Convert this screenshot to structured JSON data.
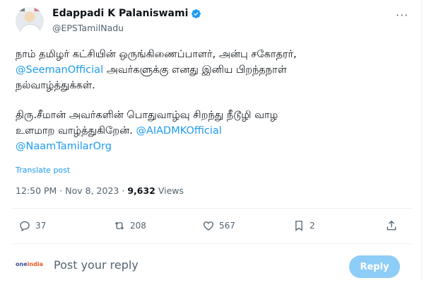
{
  "author": {
    "display_name": "Edappadi K Palaniswami",
    "handle": "@EPSTamilNadu",
    "verified": true
  },
  "tweet": {
    "para1_line1": "நாம் தமிழர் கட்சியின் ஒருங்கிணைப்பாளர், அன்பு சகோதரர்,",
    "para1_mention": "@SeemanOfficial",
    "para1_line2_rest": " அவர்களுக்கு எனது இனிய பிறந்தநாள்",
    "para1_line3": "நல்வாழ்த்துக்கள்.",
    "para2_line1": "திரு.சீமான் அவர்களின் பொதுவாழ்வு சிறந்து நீடூழி வாழ",
    "para2_line2": "உளமாற வாழ்த்துகிறேன்.",
    "para2_mention1": "@AIADMKOfficial",
    "para2_mention2": "@NaamTamilarOrg",
    "translate_label": "Translate post"
  },
  "meta": {
    "time": "12:50 PM",
    "date": "Nov 8, 2023",
    "views_count": "9,632",
    "views_label": "Views",
    "separator": "·"
  },
  "actions": {
    "replies": "37",
    "reposts": "208",
    "likes": "567",
    "bookmarks": "2"
  },
  "reply_box": {
    "brand_left": "one",
    "brand_right": "india",
    "placeholder": "Post your reply",
    "button_label": "Reply"
  },
  "colors": {
    "link": "#1d9bf0",
    "secondary_text": "#536471",
    "reply_button_disabled": "#8ecdf7"
  },
  "icons": [
    "verified-badge-icon",
    "more-icon",
    "reply-icon",
    "repost-icon",
    "like-icon",
    "bookmark-icon",
    "share-icon"
  ]
}
